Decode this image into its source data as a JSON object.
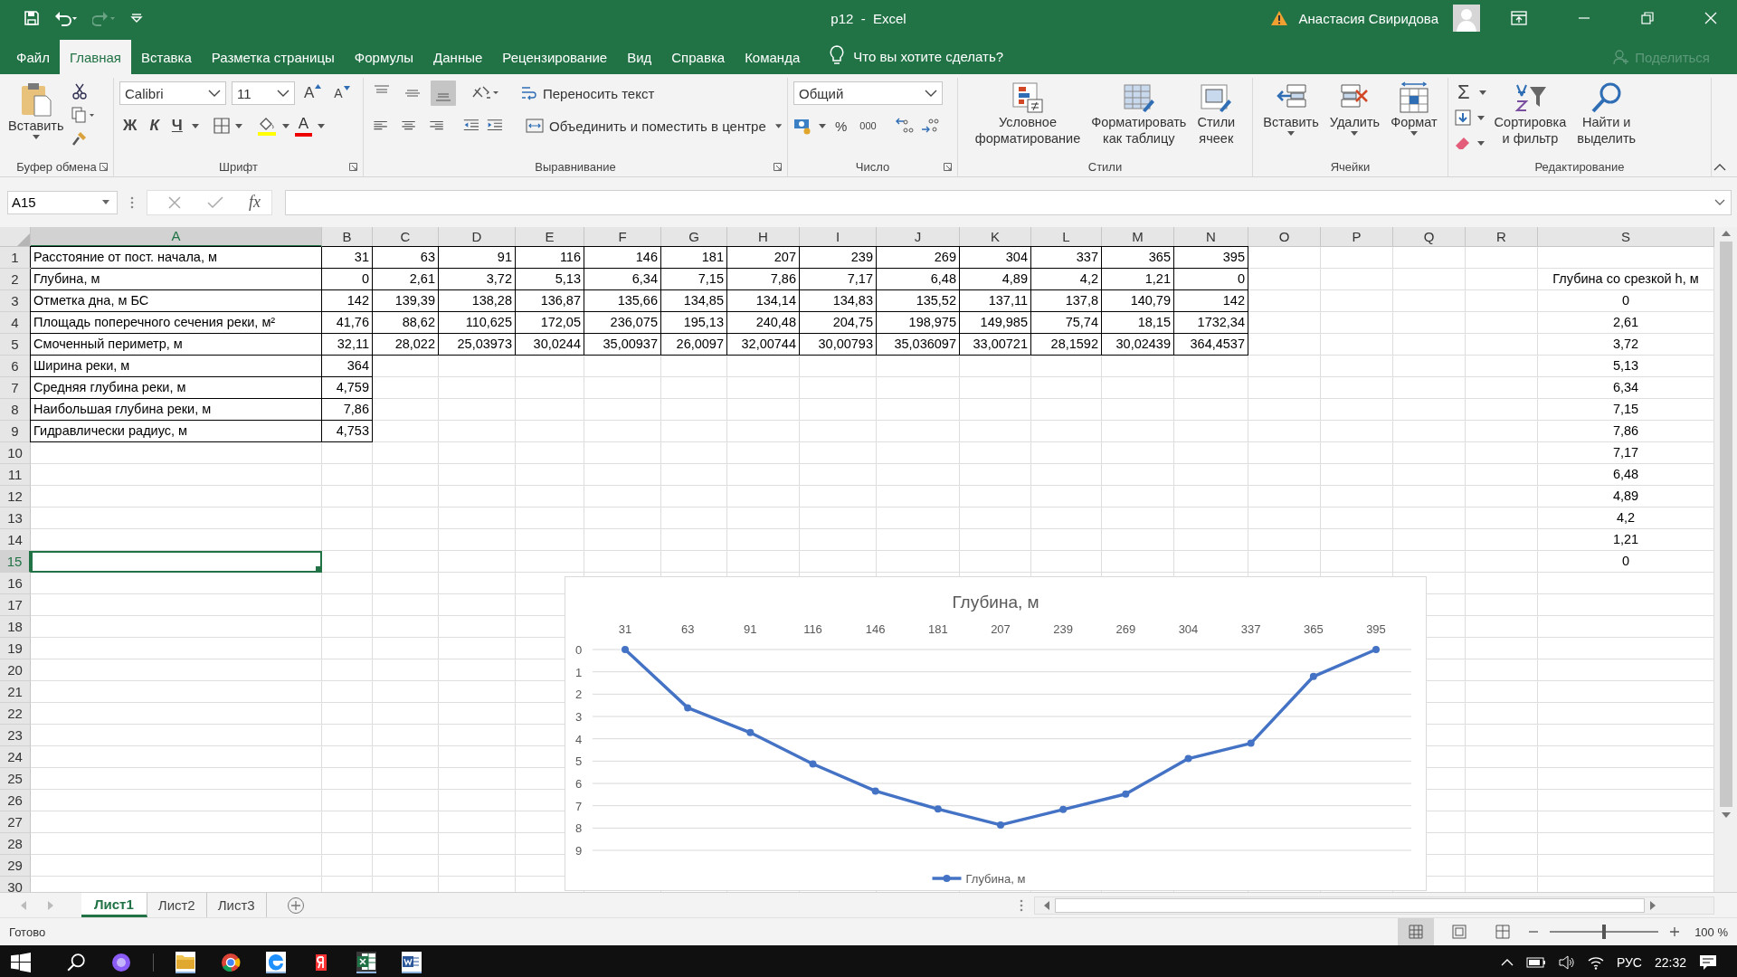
{
  "title_bar": {
    "title": "p12  -  Excel",
    "user": "Анастасия Свиридова"
  },
  "menu_tabs": [
    {
      "label": "Файл",
      "selected": false
    },
    {
      "label": "Главная",
      "selected": true
    },
    {
      "label": "Вставка",
      "selected": false
    },
    {
      "label": "Разметка страницы",
      "selected": false
    },
    {
      "label": "Формулы",
      "selected": false
    },
    {
      "label": "Данные",
      "selected": false
    },
    {
      "label": "Рецензирование",
      "selected": false
    },
    {
      "label": "Вид",
      "selected": false
    },
    {
      "label": "Справка",
      "selected": false
    },
    {
      "label": "Команда",
      "selected": false
    }
  ],
  "tell_me": "Что вы хотите сделать?",
  "share": "Поделиться",
  "ribbon": {
    "clipboard": {
      "paste": "Вставить",
      "group": "Буфер обмена"
    },
    "font": {
      "name": "Calibri",
      "size": "11",
      "grow": "A",
      "shrink": "A",
      "bold": "Ж",
      "italic": "К",
      "underline": "Ч",
      "color_letter": "A",
      "group": "Шрифт"
    },
    "alignment": {
      "vertical": [
        {
          "selected": false
        },
        {
          "selected": false
        },
        {
          "selected": true
        }
      ],
      "wrap": "Переносить текст",
      "merge": "Объединить и поместить в центре",
      "group": "Выравнивание"
    },
    "number": {
      "format": "Общий",
      "percent": "%",
      "thousands": "000",
      "group": "Число"
    },
    "styles": {
      "buttons": [
        {
          "lines": [
            "Условное",
            "форматирование"
          ]
        },
        {
          "lines": [
            "Форматировать",
            "как таблицу"
          ]
        },
        {
          "lines": [
            "Стили",
            "ячеек"
          ]
        }
      ],
      "group": "Стили"
    },
    "cells": {
      "buttons": [
        {
          "lines": [
            "Вставить"
          ]
        },
        {
          "lines": [
            "Удалить"
          ]
        },
        {
          "lines": [
            "Формат"
          ]
        }
      ],
      "group": "Ячейки"
    },
    "editing": {
      "sum": "Σ",
      "buttons": [
        {
          "lines": [
            "Сортировка",
            "и фильтр"
          ]
        },
        {
          "lines": [
            "Найти и",
            "выделить"
          ]
        }
      ],
      "group": "Редактирование"
    }
  },
  "formula_bar": {
    "name_box": "A15",
    "fx": "fx"
  },
  "columns": [
    {
      "label": "A",
      "selected": true
    },
    {
      "label": "B",
      "selected": false
    },
    {
      "label": "C",
      "selected": false
    },
    {
      "label": "D",
      "selected": false
    },
    {
      "label": "E",
      "selected": false
    },
    {
      "label": "F",
      "selected": false
    },
    {
      "label": "G",
      "selected": false
    },
    {
      "label": "H",
      "selected": false
    },
    {
      "label": "I",
      "selected": false
    },
    {
      "label": "J",
      "selected": false
    },
    {
      "label": "K",
      "selected": false
    },
    {
      "label": "L",
      "selected": false
    },
    {
      "label": "M",
      "selected": false
    },
    {
      "label": "N",
      "selected": false
    },
    {
      "label": "O",
      "selected": false
    },
    {
      "label": "P",
      "selected": false
    },
    {
      "label": "Q",
      "selected": false
    },
    {
      "label": "R",
      "selected": false
    },
    {
      "label": "S",
      "selected": false
    }
  ],
  "rows": [
    {
      "number": "1",
      "selected": false,
      "cells": [
        "Расстояние от пост. начала, м",
        "31",
        "63",
        "91",
        "116",
        "146",
        "181",
        "207",
        "239",
        "269",
        "304",
        "337",
        "365",
        "395"
      ]
    },
    {
      "number": "2",
      "selected": false,
      "cells": [
        "Глубина, м",
        "0",
        "2,61",
        "3,72",
        "5,13",
        "6,34",
        "7,15",
        "7,86",
        "7,17",
        "6,48",
        "4,89",
        "4,2",
        "1,21",
        "0"
      ],
      "s_cell": "Глубина со срезкой h, м"
    },
    {
      "number": "3",
      "selected": false,
      "cells": [
        "Отметка дна, м БС",
        "142",
        "139,39",
        "138,28",
        "136,87",
        "135,66",
        "134,85",
        "134,14",
        "134,83",
        "135,52",
        "137,11",
        "137,8",
        "140,79",
        "142"
      ],
      "s_cell": "0"
    },
    {
      "number": "4",
      "selected": false,
      "cells": [
        "Площадь поперечного сечения реки, м²",
        "41,76",
        "88,62",
        "110,625",
        "172,05",
        "236,075",
        "195,13",
        "240,48",
        "204,75",
        "198,975",
        "149,985",
        "75,74",
        "18,15",
        "1732,34"
      ],
      "s_cell": "2,61"
    },
    {
      "number": "5",
      "selected": false,
      "cells": [
        "Смоченный периметр, м",
        "32,11",
        "28,022",
        "25,03973",
        "30,0244",
        "35,00937",
        "26,0097",
        "32,00744",
        "30,00793",
        "35,036097",
        "33,00721",
        "28,1592",
        "30,02439",
        "364,4537"
      ],
      "s_cell": "3,72"
    },
    {
      "number": "6",
      "selected": false,
      "cells": [
        "Ширина реки, м",
        "364"
      ],
      "s_cell": "5,13"
    },
    {
      "number": "7",
      "selected": false,
      "cells": [
        "Средняя глубина реки, м",
        "4,759"
      ],
      "s_cell": "6,34"
    },
    {
      "number": "8",
      "selected": false,
      "cells": [
        "Наибольшая глубина реки, м",
        "7,86"
      ],
      "s_cell": "7,15"
    },
    {
      "number": "9",
      "selected": false,
      "cells": [
        "Гидравлически радиус, м",
        "4,753"
      ],
      "s_cell": "7,86"
    },
    {
      "number": "10",
      "selected": false,
      "s_cell": "7,17"
    },
    {
      "number": "11",
      "selected": false,
      "s_cell": "6,48"
    },
    {
      "number": "12",
      "selected": false,
      "s_cell": "4,89"
    },
    {
      "number": "13",
      "selected": false,
      "s_cell": "4,2"
    },
    {
      "number": "14",
      "selected": false,
      "s_cell": "1,21"
    },
    {
      "number": "15",
      "selected": true,
      "s_cell": "0"
    },
    {
      "number": "16",
      "selected": false
    },
    {
      "number": "17",
      "selected": false
    },
    {
      "number": "18",
      "selected": false
    },
    {
      "number": "19",
      "selected": false
    },
    {
      "number": "20",
      "selected": false
    },
    {
      "number": "21",
      "selected": false
    },
    {
      "number": "22",
      "selected": false
    },
    {
      "number": "23",
      "selected": false
    },
    {
      "number": "24",
      "selected": false
    },
    {
      "number": "25",
      "selected": false
    },
    {
      "number": "26",
      "selected": false
    },
    {
      "number": "27",
      "selected": false
    },
    {
      "number": "28",
      "selected": false
    },
    {
      "number": "29",
      "selected": false
    },
    {
      "number": "30",
      "selected": false
    }
  ],
  "chart": {
    "chart_data": {
      "type": "line",
      "title": "Глубина, м",
      "categories": [
        "31",
        "63",
        "91",
        "116",
        "146",
        "181",
        "207",
        "239",
        "269",
        "304",
        "337",
        "365",
        "395"
      ],
      "series": [
        {
          "name": "Глубина, м",
          "color": "#4472c4",
          "values": [
            0,
            2.61,
            3.72,
            5.13,
            6.34,
            7.15,
            7.86,
            7.17,
            6.48,
            4.89,
            4.2,
            1.21,
            0
          ]
        }
      ],
      "ylim": [
        9,
        0
      ],
      "yticks": [
        0,
        1,
        2,
        3,
        4,
        5,
        6,
        7,
        8,
        9
      ],
      "grid": true,
      "marker": true
    }
  },
  "sheet_tabs": [
    {
      "label": "Лист1",
      "selected": true
    },
    {
      "label": "Лист2",
      "selected": false
    },
    {
      "label": "Лист3",
      "selected": false
    }
  ],
  "status_bar": {
    "status": "Готово",
    "zoom": "100 %",
    "zoom_slider": {
      "level": 0.5
    }
  },
  "taskbar": {
    "language": "РУС",
    "time": "22:32"
  }
}
